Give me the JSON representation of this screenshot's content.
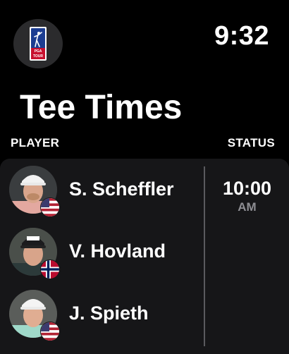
{
  "status_bar": {
    "time": "9:32"
  },
  "app": {
    "logo_icon": "pga-tour-logo-icon",
    "logo_text_top": "PGA",
    "logo_text_bottom": "TOUR"
  },
  "header": {
    "title": "Tee Times"
  },
  "columns": {
    "player": "PLAYER",
    "status": "STATUS"
  },
  "group": {
    "tee_time": "10:00",
    "tee_ampm": "AM",
    "players": [
      {
        "name": "S. Scheffler",
        "flag": "usa-flag-icon"
      },
      {
        "name": "V. Hovland",
        "flag": "norway-flag-icon"
      },
      {
        "name": "J. Spieth",
        "flag": "usa-flag-icon"
      }
    ]
  },
  "colors": {
    "background": "#000000",
    "panel": "#161618",
    "divider": "#5a5a5e",
    "secondary_text": "#8e8e93",
    "pga_blue": "#1c3d91",
    "pga_red": "#c8102e"
  }
}
